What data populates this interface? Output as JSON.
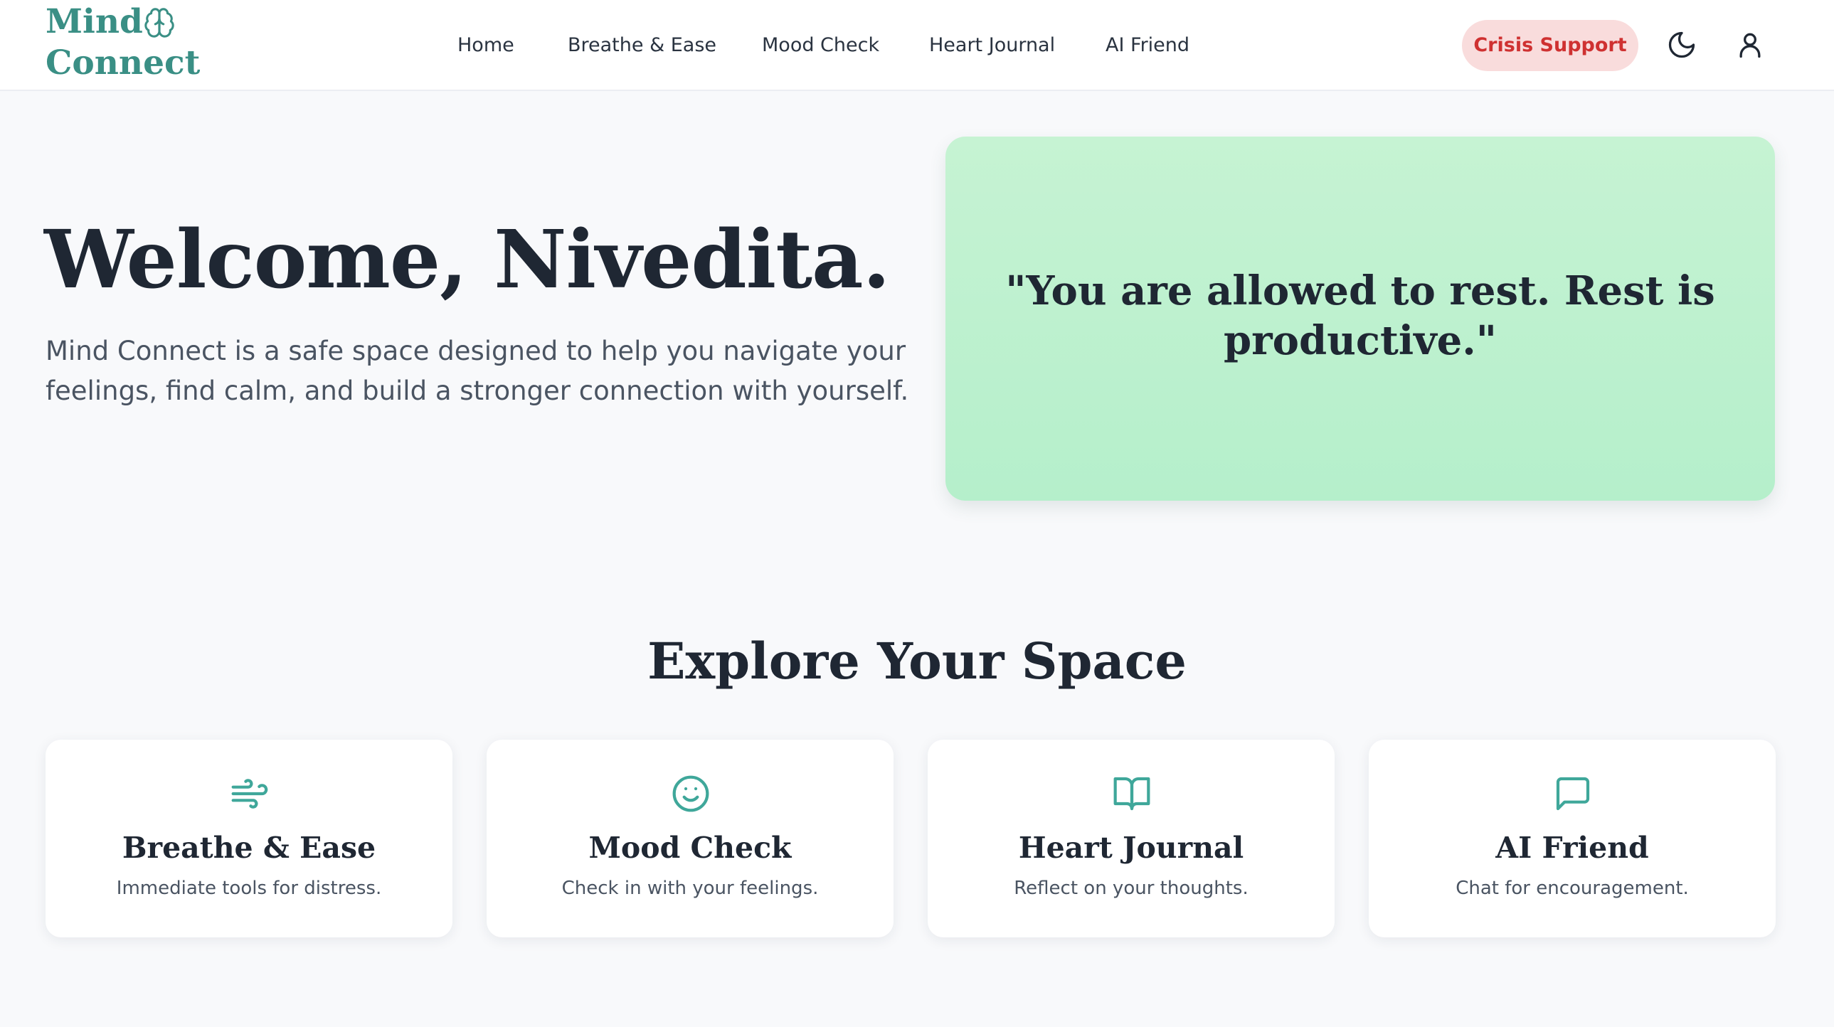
{
  "app": {
    "logo_line1": "Mind",
    "logo_line2": "Connect",
    "accent_color": "#3a8f85",
    "logo_icon": "brain-icon"
  },
  "nav": {
    "items": [
      {
        "label": "Home"
      },
      {
        "label": "Breathe & Ease"
      },
      {
        "label": "Mood Check"
      },
      {
        "label": "Heart Journal"
      },
      {
        "label": "AI Friend"
      }
    ],
    "crisis_label": "Crisis Support",
    "crisis_color": "#cf3131",
    "theme_icon": "moon-icon",
    "profile_icon": "user-icon"
  },
  "hero": {
    "welcome": "Welcome, Nivedita.",
    "intro": "Mind Connect is a safe space designed to help you navigate your feelings, find calm, and build a stronger connection with yourself.",
    "quote": "\"You are allowed to rest. Rest is productive.\""
  },
  "explore": {
    "title": "Explore Your Space",
    "cards": [
      {
        "icon": "wind-icon",
        "title": "Breathe & Ease",
        "subtitle": "Immediate tools for distress."
      },
      {
        "icon": "smile-icon",
        "title": "Mood Check",
        "subtitle": "Check in with your feelings."
      },
      {
        "icon": "book-open-icon",
        "title": "Heart Journal",
        "subtitle": "Reflect on your thoughts."
      },
      {
        "icon": "message-square-icon",
        "title": "AI Friend",
        "subtitle": "Chat for encouragement."
      }
    ]
  }
}
